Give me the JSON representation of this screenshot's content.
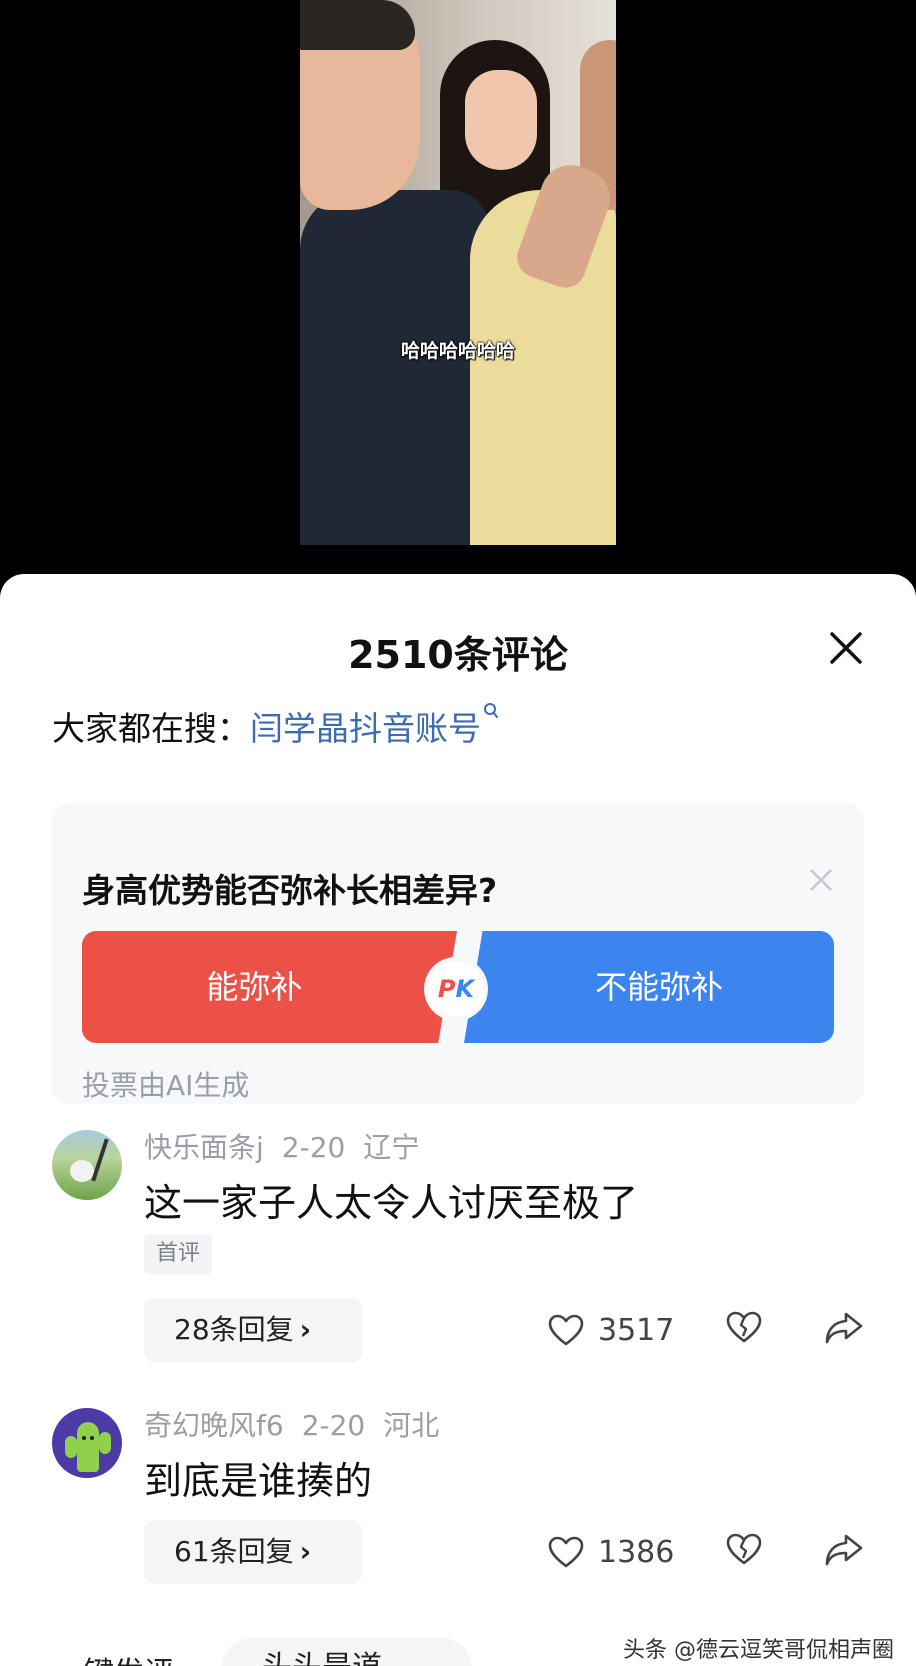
{
  "video": {
    "caption": "哈哈哈哈哈哈"
  },
  "panel": {
    "title": "2510条评论",
    "hot_search_label": "大家都在搜：",
    "hot_search_term": "闫学晶抖音账号"
  },
  "poll": {
    "question": "身高优势能否弥补长相差异?",
    "option_yes": "能弥补",
    "option_no": "不能弥补",
    "pk_p": "P",
    "pk_k": "K",
    "footnote": "投票由AI生成",
    "colors": {
      "yes": "#ec5147",
      "no": "#3c84ee"
    }
  },
  "comments": [
    {
      "user": "快乐面条j",
      "date": "2-20",
      "location": "辽宁",
      "text": "这一家子人太令人讨厌至极了",
      "tag": "首评",
      "replies": "28条回复",
      "likes": "3517",
      "avatar_icon": "golf-avatar"
    },
    {
      "user": "奇幻晚风f6",
      "date": "2-20",
      "location": "河北",
      "text": "到底是谁揍的",
      "replies": "61条回复",
      "likes": "1386",
      "avatar_icon": "cactus-avatar"
    }
  ],
  "bottom": {
    "hint": "键发评",
    "pill": "头头是道",
    "watermark": "头条 @德云逗笑哥侃相声圈"
  }
}
